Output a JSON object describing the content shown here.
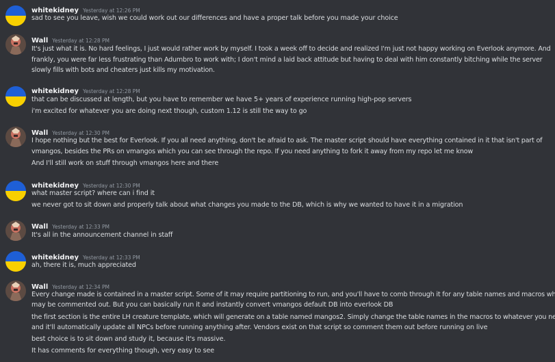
{
  "colors": {
    "background": "#313338",
    "text": "#dbdee1",
    "author": "#f2f3f5",
    "timestamp": "#949ba4",
    "flag_blue": "#1e5fd6",
    "flag_yellow": "#f8d000"
  },
  "messages": [
    {
      "author": "whitekidney",
      "avatar_icon": "ukraine-flag-avatar-icon",
      "time": "Yesterday at 12:26 PM",
      "lines": [
        "sad to see you leave, wish we could work out our differences and have a proper talk before you made your choice"
      ]
    },
    {
      "author": "Wall",
      "avatar_icon": "fantasy-character-avatar-icon",
      "time": "Yesterday at 12:28 PM",
      "lines": [
        "It's just what it is. No hard feelings, I just would rather work by myself. I took a week off to decide and realized I'm just not happy working on Everlook anymore. And",
        "frankly, you were far less frustrating than Adumbro to work with; I don't mind a laid back attitude but having to deal with him constantly bitching while the server",
        "slowly fills with bots and cheaters just kills my motivation."
      ]
    },
    {
      "author": "whitekidney",
      "avatar_icon": "ukraine-flag-avatar-icon",
      "time": "Yesterday at 12:28 PM",
      "lines": [
        "that can be discussed at length, but you have to remember we have 5+ years of experience running high-pop servers",
        "i'm excited for whatever you are doing next though, custom 1.12 is still the way to go"
      ]
    },
    {
      "author": "Wall",
      "avatar_icon": "fantasy-character-avatar-icon",
      "time": "Yesterday at 12:30 PM",
      "lines": [
        "I hope nothing but the best for Everlook. If you all need anything, don't be afraid to ask. The master script should have everything contained in it that isn't part of",
        "vmangos, besides the PRs on vmangos which you can see through the repo. If you need anything to fork it away from my repo let me know",
        "And I'll still work on stuff through vmangos here and there"
      ]
    },
    {
      "author": "whitekidney",
      "avatar_icon": "ukraine-flag-avatar-icon",
      "time": "Yesterday at 12:30 PM",
      "lines": [
        "what master script? where can i find it",
        "we never got to sit down and properly talk about what changes you made to the DB, which is why we wanted to have it in a migration"
      ]
    },
    {
      "author": "Wall",
      "avatar_icon": "fantasy-character-avatar-icon",
      "time": "Yesterday at 12:33 PM",
      "lines": [
        "It's all in the announcement channel in staff"
      ]
    },
    {
      "author": "whitekidney",
      "avatar_icon": "ukraine-flag-avatar-icon",
      "time": "Yesterday at 12:33 PM",
      "lines": [
        "ah, there it is, much appreciated"
      ]
    },
    {
      "author": "Wall",
      "avatar_icon": "fantasy-character-avatar-icon",
      "time": "Yesterday at 12:34 PM",
      "lines": [
        "Every change made is contained in a master script. Some of it may require partitioning to run, and you'll have to comb through it for any table names and macros which",
        "may be commented out. But you can basically run it and instantly convert vmangos default DB into everlook DB",
        "the first section is the entire LH creature template, which will generate on a table named mangos2. Simply change the table names in the macros to whatever you need",
        "and it'll automatically update all NPCs before running anything after. Vendors exist on that script so comment them out before running on live",
        "best choice is to sit down and study it, because it's massive.",
        "It has comments for everything though, very easy to see"
      ]
    }
  ]
}
